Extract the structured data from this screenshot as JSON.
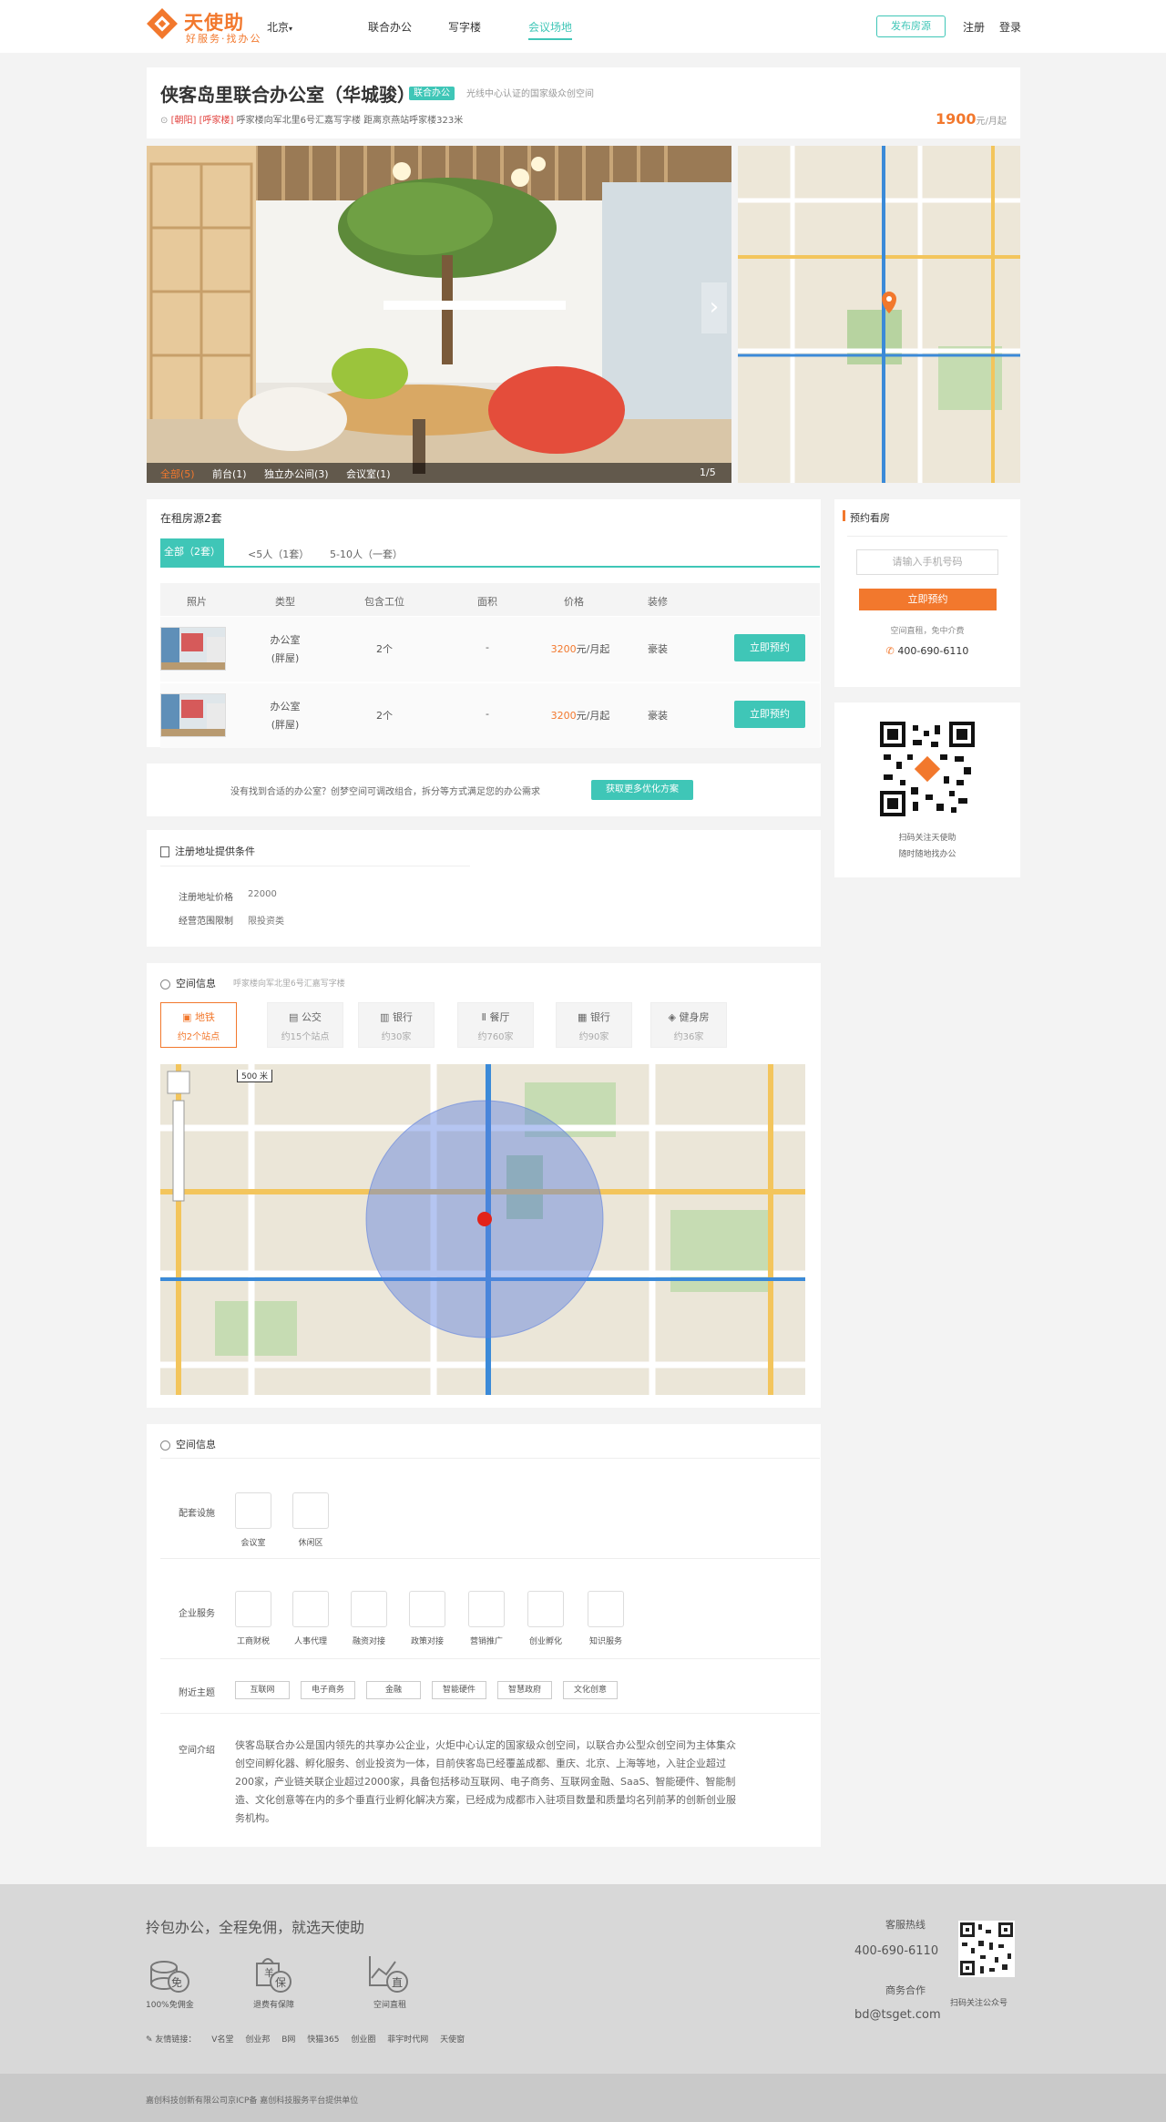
{
  "header": {
    "logo_text": "天使助",
    "logo_sub": "好服务·找办公",
    "city": "北京",
    "nav": [
      "联合办公",
      "写字楼",
      "会议场地"
    ],
    "publish_label": "发布房源",
    "register": "注册",
    "login": "登录"
  },
  "listing": {
    "title": "侠客岛里联合办公室（华城骏）",
    "badge": "联合办公",
    "tagline": "光线中心认证的国家级众创空间",
    "tag1": "[朝阳]",
    "tag2": "[呼家楼]",
    "address": "呼家楼向军北里6号汇嘉写字楼 距离京燕站呼家楼323米",
    "price_value": "1900",
    "price_unit": "元/月起",
    "photo_tabs": [
      "全部(5)",
      "前台(1)",
      "独立办公间(3)",
      "会议室(1)"
    ],
    "photo_count": "1/5"
  },
  "rooms": {
    "heading": "在租房源2套",
    "tabs": [
      "全部（2套）",
      "<5人（1套）",
      "5-10人（一套）"
    ],
    "columns": [
      "照片",
      "类型",
      "包含工位",
      "面积",
      "价格",
      "装修"
    ],
    "rows": [
      {
        "type1": "办公室",
        "type2": "(胖屋)",
        "seats": "2个",
        "area": "-",
        "price": "3200",
        "price_unit": "元/月起",
        "decor": "豪装",
        "action": "立即预约"
      },
      {
        "type1": "办公室",
        "type2": "(胖屋)",
        "seats": "2个",
        "area": "-",
        "price": "3200",
        "price_unit": "元/月起",
        "decor": "豪装",
        "action": "立即预约"
      }
    ]
  },
  "promo": {
    "text": "没有找到合适的办公室？创梦空间可调改组合，拆分等方式满足您的办公需求",
    "button": "获取更多优化方案"
  },
  "reg": {
    "heading": "注册地址提供条件",
    "price_label": "注册地址价格",
    "price_value": "22000",
    "scope_label": "经营范围限制",
    "scope_value": "限投资类"
  },
  "traffic": {
    "heading": "空间信息",
    "subheading": "呼家楼向军北里6号汇嘉写字楼",
    "tabs": [
      {
        "label": "地铁",
        "sub": "约2个站点"
      },
      {
        "label": "公交",
        "sub": "约15个站点"
      },
      {
        "label": "银行",
        "sub": "约30家"
      },
      {
        "label": "餐厅",
        "sub": "约760家"
      },
      {
        "label": "银行",
        "sub": "约90家"
      },
      {
        "label": "健身房",
        "sub": "约36家"
      }
    ],
    "scale": "500 米"
  },
  "space": {
    "heading": "空间信息",
    "facility_label": "配套设施",
    "facilities": [
      "会议室",
      "休闲区"
    ],
    "service_label": "企业服务",
    "services": [
      "工商财税",
      "人事代理",
      "融资对接",
      "政策对接",
      "营销推广",
      "创业孵化",
      "知识服务"
    ],
    "nearby_label": "附近主题",
    "nearby": [
      "互联网",
      "电子商务",
      "金融",
      "智能硬件",
      "智慧政府",
      "文化创意"
    ],
    "intro_label": "空间介绍",
    "intro": "侠客岛联合办公是国内领先的共享办公企业，火炬中心认定的国家级众创空间，以联合办公型众创空间为主体集众创空间孵化器、孵化服务、创业投资为一体，目前侠客岛已经覆盖成都、重庆、北京、上海等地，入驻企业超过200家，产业链关联企业超过2000家，具备包括移动互联网、电子商务、互联网金融、SaaS、智能硬件、智能制造、文化创意等在内的多个垂直行业孵化解决方案，已经成为成都市入驻项目数量和质量均名列前茅的创新创业服务机构。"
  },
  "sidebar": {
    "heading": "预约看房",
    "placeholder": "请输入手机号码",
    "button": "立即预约",
    "note": "空间直租，免中介费",
    "phone": "400-690-6110",
    "qr_line1": "扫码关注天使助",
    "qr_line2": "随时随地找办公"
  },
  "footer": {
    "slogan": "拎包办公，全程免佣，就选天使助",
    "icons": [
      {
        "char": "免",
        "label": "100%免佣金"
      },
      {
        "char": "保",
        "label": "退费有保障"
      },
      {
        "char": "直",
        "label": "空间直租"
      }
    ],
    "hotline_label": "客服热线",
    "hotline": "400-690-6110",
    "biz_label": "商务合作",
    "email": "bd@tsget.com",
    "qr_caption": "扫码关注公众号",
    "links_label": "友情链接：",
    "links": [
      "V名堂",
      "创业邦",
      "B网",
      "快猫365",
      "创业圈",
      "菲宇时代网",
      "天使窗"
    ],
    "copyright": "嘉创科技创新有限公司京ICP备 嘉创科技服务平台提供单位"
  },
  "colors": {
    "accent": "#3fc6b7",
    "brand": "#f2782d"
  }
}
